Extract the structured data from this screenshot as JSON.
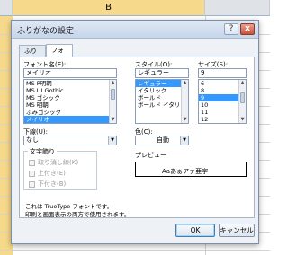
{
  "excel": {
    "columns": [
      {
        "label": ""
      },
      {
        "label": "B"
      },
      {
        "label": ""
      }
    ],
    "active_column": "B"
  },
  "dialog": {
    "title": "ふりがなの設定",
    "help_button": "?",
    "close_button": "x",
    "tabs": [
      {
        "label": "ふりがな",
        "active": false
      },
      {
        "label": "フォント",
        "active": true
      }
    ],
    "font": {
      "label": "フォント名(E):",
      "value": "メイリオ",
      "items": [
        "MS P明朝",
        "MS UI Gothic",
        "MS ゴシック",
        "MS 明朝",
        "ふみゴシック",
        "メイリオ"
      ],
      "selected_index": 5
    },
    "style": {
      "label": "スタイル(O):",
      "value": "レギュラー",
      "items": [
        "レギュラー",
        "イタリック",
        "ボールド",
        "ボールド イタリック"
      ],
      "selected_index": 0
    },
    "size": {
      "label": "サイズ(S):",
      "value": "9",
      "items": [
        "6",
        "8",
        "9",
        "10",
        "11",
        "12"
      ],
      "selected_index": 2
    },
    "underline": {
      "label": "下線(U):",
      "value": "なし"
    },
    "color": {
      "label": "色(C):",
      "value": "自動"
    },
    "effects": {
      "title": "文字飾り",
      "items": [
        "取り消し線(K)",
        "上付き(E)",
        "下付き(B)"
      ]
    },
    "preview": {
      "title": "プレビュー",
      "sample": "Aaあぁアァ亜宇"
    },
    "note": [
      "これは TrueType フォントです。",
      "印刷と画面表示の両方で使用されます。"
    ],
    "ok_label": "OK",
    "cancel_label": "キャンセル"
  }
}
